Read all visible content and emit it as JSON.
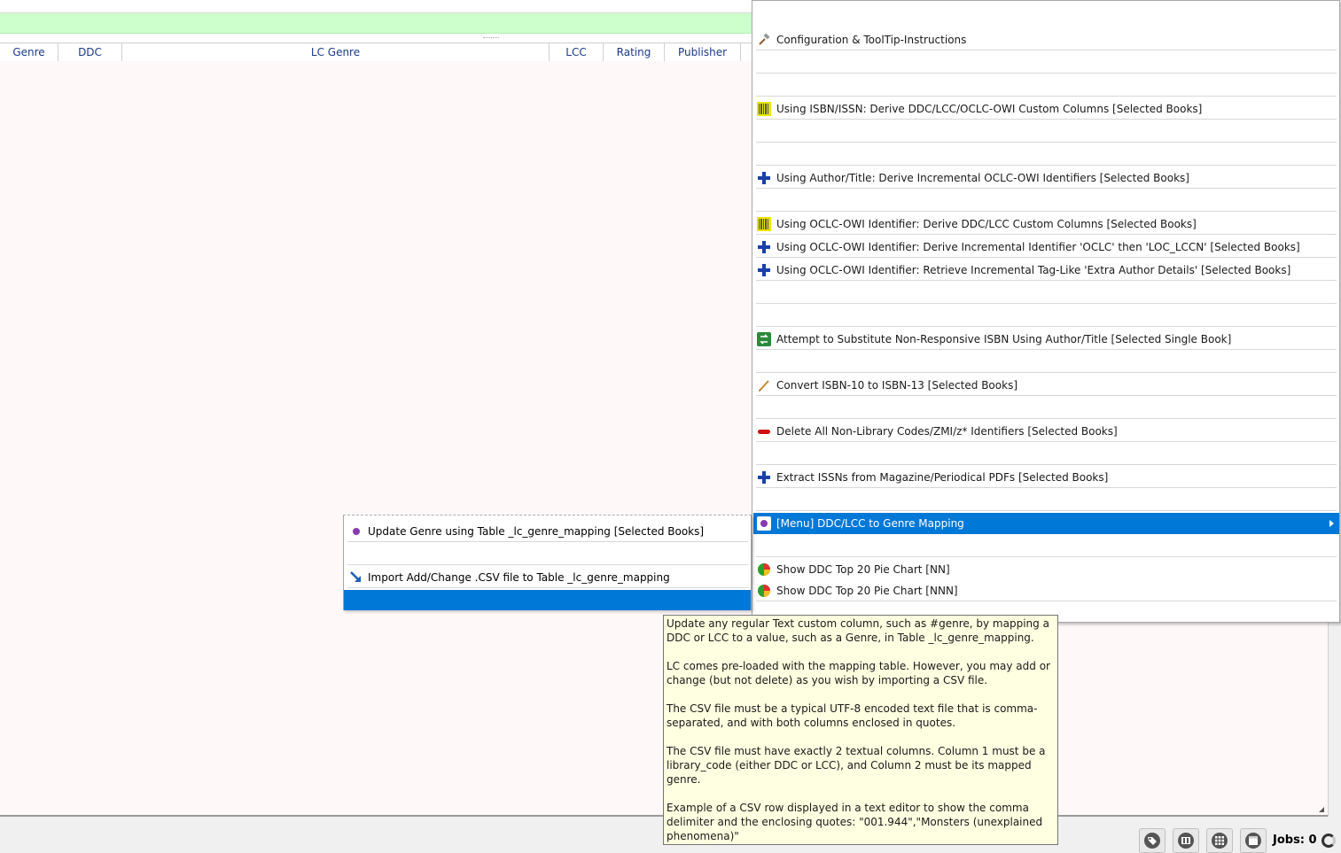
{
  "table": {
    "columns": [
      "Genre",
      "DDC",
      "LC Genre",
      "LCC",
      "Rating",
      "Publisher"
    ]
  },
  "menu": {
    "items": [
      {
        "label": "Configuration & ToolTip-Instructions",
        "icon": "hammer-icon"
      },
      {
        "label": "Using ISBN/ISSN:  Derive DDC/LCC/OCLC-OWI Custom Columns [Selected Books]",
        "icon": "barcode-icon"
      },
      {
        "label": "Using Author/Title:  Derive Incremental OCLC-OWI Identifiers [Selected Books]",
        "icon": "plus-icon"
      },
      {
        "label": "Using OCLC-OWI Identifier:  Derive DDC/LCC Custom Columns  [Selected Books]",
        "icon": "barcode-icon"
      },
      {
        "label": "Using OCLC-OWI Identifier:  Derive Incremental Identifier 'OCLC' then 'LOC_LCCN' [Selected Books]",
        "icon": "plus-icon"
      },
      {
        "label": "Using OCLC-OWI Identifier:  Retrieve Incremental Tag-Like 'Extra Author Details' [Selected Books]",
        "icon": "plus-icon"
      },
      {
        "label": "Attempt to Substitute Non-Responsive ISBN Using Author/Title [Selected Single Book]",
        "icon": "substitute-icon"
      },
      {
        "label": "Convert ISBN-10 to ISBN-13 [Selected Books]",
        "icon": "pencil-icon"
      },
      {
        "label": "Delete All Non-Library Codes/ZMI/z* Identifiers [Selected Books]",
        "icon": "delete-icon"
      },
      {
        "label": "Extract ISSNs from Magazine/Periodical PDFs [Selected Books]",
        "icon": "plus-icon"
      },
      {
        "label": "[Menu] DDC/LCC to Genre Mapping",
        "icon": "genre-mapping-icon"
      },
      {
        "label": "Show DDC Top 20 Pie Chart [NN]",
        "icon": "pie-chart-icon"
      },
      {
        "label": "Show DDC Top 20 Pie Chart [NNN]",
        "icon": "pie-chart-icon"
      }
    ]
  },
  "submenu": {
    "items": [
      {
        "label": "Update Genre using Table _lc_genre_mapping [Selected Books]",
        "icon": "purple-dot-icon"
      },
      {
        "label": "Import Add/Change .CSV file to Table _lc_genre_mapping",
        "icon": "import-arrow-icon"
      }
    ]
  },
  "tooltip": {
    "paragraphs": [
      "Update any regular Text custom column, such as #genre, by mapping a DDC or LCC to a value, such as a Genre, in Table _lc_genre_mapping.",
      "LC comes pre-loaded with the mapping table. However, you may add or change (but not delete) as you wish by importing a CSV file.",
      "The CSV file must be a typical UTF-8 encoded text file that is comma-separated, and with both columns enclosed in quotes.",
      "The CSV file must have exactly 2 textual columns. Column 1 must be a library_code (either DDC or LCC), and Column 2 must be its mapped genre.",
      "Example of a CSV row displayed in a text editor to show the comma delimiter and the enclosing quotes: \"001.944\",\"Monsters (unexplained phenomena)\""
    ]
  },
  "statusbar": {
    "jobs_label": "Jobs: 0"
  },
  "colors": {
    "highlight": "#0078d7",
    "green_bar": "#ccffcc",
    "tooltip_bg": "#ffffe1",
    "table_bg": "#fff8f8"
  }
}
